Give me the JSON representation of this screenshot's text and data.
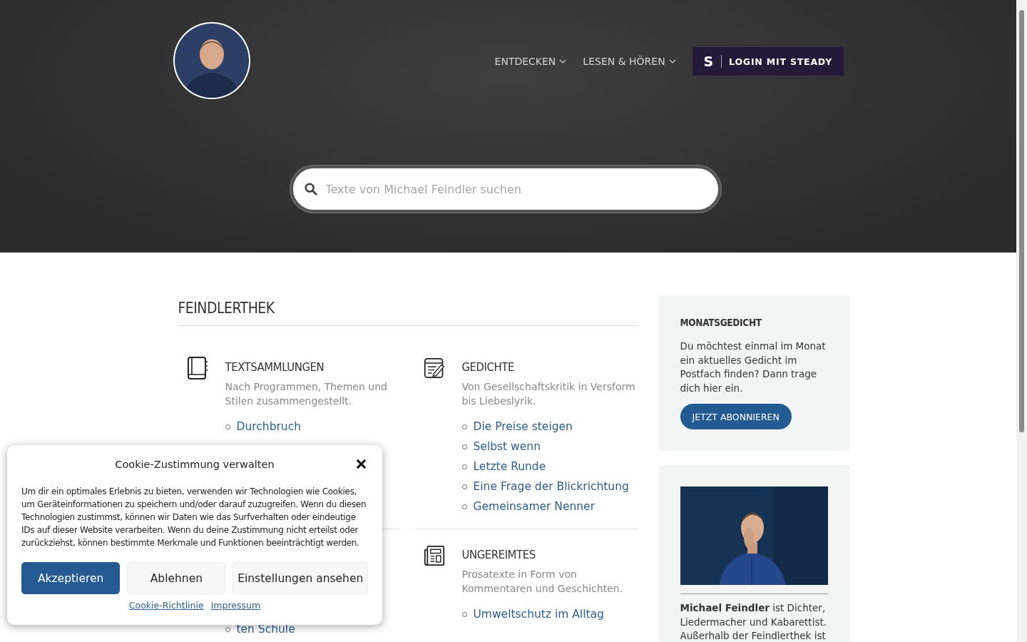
{
  "nav": [
    {
      "label": "ENTDECKEN",
      "has_menu": true
    },
    {
      "label": "LESEN & HÖREN",
      "has_menu": true
    }
  ],
  "login_button": {
    "logo": "S",
    "label": "LOGIN MIT STEADY"
  },
  "search": {
    "placeholder": "Texte von Michael Feindler suchen"
  },
  "main": {
    "title": "FEINDLERTHEK",
    "sections": [
      {
        "title": "TEXTSAMMLUNGEN",
        "description": "Nach Programmen, Themen und Stilen zusammengestellt.",
        "links": [
          "Durchbruch"
        ]
      },
      {
        "title": "GEDICHTE",
        "description": "Von Gesellschaftskritik in Versform bis Liebeslyrik.",
        "links": [
          "Die Preise steigen",
          "Selbst wenn",
          "Letzte Runde",
          "Eine Frage der Blickrichtung",
          "Gemeinsamer Nenner"
        ]
      },
      {
        "links": [
          "ten Schule"
        ]
      },
      {
        "title": "UNGEREIMTES",
        "description": "Prosatexte in Form von Kommentaren und Geschichten.",
        "links": [
          "Umweltschutz im Alltag"
        ]
      }
    ]
  },
  "sidebar": {
    "newsletter": {
      "title": "MONATSGEDICHT",
      "text": "Du möchtest einmal im Monat ein aktuelles Gedicht im Postfach finden? Dann trage dich hier ein.",
      "button": "JETZT ABONNIEREN"
    },
    "about": {
      "text": "**Michael Feindler** ist Dichter, Liedermacher und Kabarettist. Außerhalb der Feindlerthek ist"
    }
  },
  "cookie_dialog": {
    "title": "Cookie-Zustimmung verwalten",
    "text": "Um dir ein optimales Erlebnis zu bieten, verwenden wir Technologien wie Cookies, um Geräteinformationen zu speichern und/oder darauf zuzugreifen. Wenn du diesen Technologien zustimmst, können wir Daten wie das Surfverhalten oder eindeutige IDs auf dieser Website verarbeiten. Wenn du deine Zustimmung nicht erteilst oder zurückziehst, können bestimmte Merkmale und Funktionen beeinträchtigt werden.",
    "buttons": [
      {
        "label": "Akzeptieren",
        "kind": "primary"
      },
      {
        "label": "Ablehnen",
        "kind": "secondary"
      },
      {
        "label": "Einstellungen ansehen",
        "kind": "secondary"
      }
    ],
    "links": [
      "Cookie-Richtlinie",
      "Impressum"
    ]
  }
}
